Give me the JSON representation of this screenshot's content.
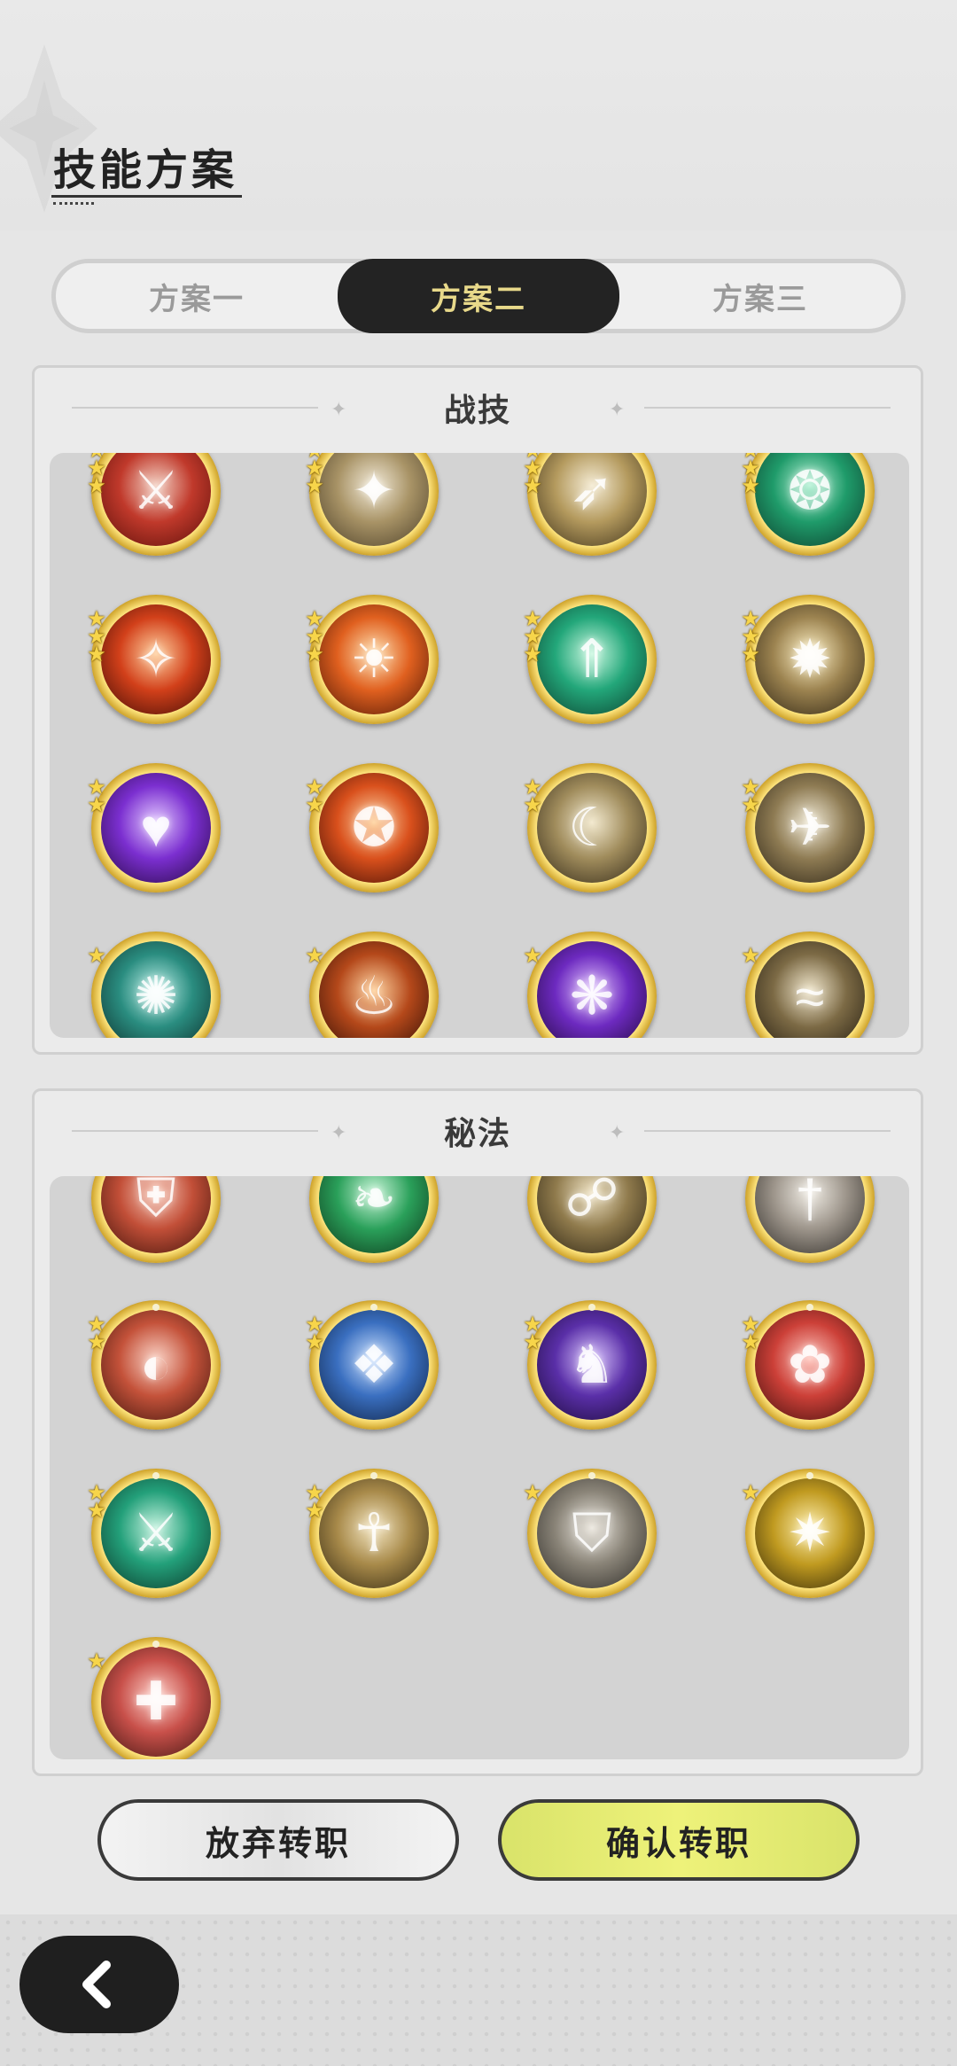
{
  "header": {
    "title": "技能方案"
  },
  "tabs": [
    {
      "label": "方案一",
      "active": false
    },
    {
      "label": "方案二",
      "active": true
    },
    {
      "label": "方案三",
      "active": false
    }
  ],
  "panels": {
    "combat": {
      "label": "战技"
    },
    "arcane": {
      "label": "秘法"
    }
  },
  "actions": {
    "abandon_label": "放弃转职",
    "confirm_label": "确认转职"
  },
  "colors": {
    "accent_gold": "#f7d54a",
    "confirm_green": "#e6ee74",
    "tab_active_bg": "#232323",
    "tab_active_text": "#e8d98a"
  },
  "combat_skills": [
    {
      "icon": "raised-sword-icon",
      "stars": 3
    },
    {
      "icon": "afterimage-dash-icon",
      "stars": 3
    },
    {
      "icon": "leaping-strike-icon",
      "stars": 3
    },
    {
      "icon": "wind-vortex-icon",
      "stars": 3
    },
    {
      "icon": "flame-slash-icon",
      "stars": 3
    },
    {
      "icon": "fire-aura-icon",
      "stars": 3
    },
    {
      "icon": "rising-arrows-icon",
      "stars": 3
    },
    {
      "icon": "ground-burst-icon",
      "stars": 3
    },
    {
      "icon": "violet-heart-icon",
      "stars": 2
    },
    {
      "icon": "fire-emblem-icon",
      "stars": 2
    },
    {
      "icon": "crescent-slash-icon",
      "stars": 2
    },
    {
      "icon": "flying-kick-icon",
      "stars": 2
    },
    {
      "icon": "web-net-icon",
      "stars": 1
    },
    {
      "icon": "flame-ring-icon",
      "stars": 1
    },
    {
      "icon": "shadow-wings-icon",
      "stars": 1
    },
    {
      "icon": "dark-sweep-icon",
      "stars": 1
    }
  ],
  "arcane_skills": [
    {
      "icon": "armor-guard-icon",
      "stars": 1
    },
    {
      "icon": "leaf-blade-icon",
      "stars": 1
    },
    {
      "icon": "dragon-claw-icon",
      "stars": 1
    },
    {
      "icon": "sword-shield-icon",
      "stars": 1
    },
    {
      "icon": "crimson-sweep-icon",
      "stars": 2
    },
    {
      "icon": "crystal-crest-icon",
      "stars": 2
    },
    {
      "icon": "shadow-beast-icon",
      "stars": 2
    },
    {
      "icon": "red-blossom-icon",
      "stars": 2
    },
    {
      "icon": "jade-sword-icon",
      "stars": 2
    },
    {
      "icon": "golden-aura-icon",
      "stars": 2
    },
    {
      "icon": "shield-figure-icon",
      "stars": 1
    },
    {
      "icon": "radiant-burst-icon",
      "stars": 1
    },
    {
      "icon": "blood-blade-icon",
      "stars": 1
    }
  ]
}
